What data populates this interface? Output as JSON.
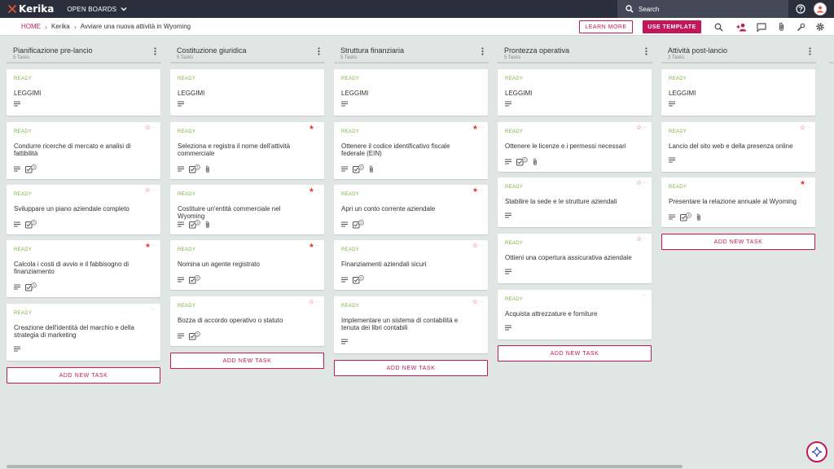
{
  "topbar": {
    "logo_text": "Kerika",
    "open_boards": "OPEN BOARDS",
    "search_placeholder": "Search"
  },
  "breadcrumb": {
    "home": "HOME",
    "org": "Kerika",
    "board": "Avviare una nuova attività in Wyoming"
  },
  "toolbar": {
    "learn_more": "LEARN MORE",
    "use_template": "USE TEMPLATE"
  },
  "add_task_label": "ADD NEW TASK",
  "colors": {
    "accent": "#c2185b",
    "ready": "#7cb342",
    "star": "#e53935",
    "topbar": "#2b2f3c"
  },
  "columns": [
    {
      "title": "Pianificazione pre-lancio",
      "count": "5 Tasks",
      "cards": [
        {
          "status": "READY",
          "title": "LEGGIMI",
          "star": "none",
          "checklist": "",
          "attachment": false
        },
        {
          "status": "READY",
          "title": "Condurre ricerche di mercato e analisi di fattibilità",
          "star": "outline",
          "checklist": "5",
          "attachment": false
        },
        {
          "status": "READY",
          "title": "Sviluppare un piano aziendale completo",
          "star": "outline",
          "checklist": "5",
          "attachment": false
        },
        {
          "status": "READY",
          "title": "Calcola i costi di avvio e il fabbisogno di finanziamento",
          "star": "filled",
          "checklist": "5",
          "attachment": false
        },
        {
          "status": "READY",
          "title": "Creazione dell'identità del marchio e della strategia di marketing",
          "star": "none",
          "checklist": "",
          "attachment": false
        }
      ]
    },
    {
      "title": "Costituzione giuridica",
      "count": "5 Tasks",
      "cards": [
        {
          "status": "READY",
          "title": "LEGGIMI",
          "star": "none",
          "checklist": "",
          "attachment": false
        },
        {
          "status": "READY",
          "title": "Seleziona e registra il nome dell'attività commerciale",
          "star": "filled",
          "checklist": "5",
          "attachment": true
        },
        {
          "status": "READY",
          "title": "Costituire un'entità commerciale nel Wyoming",
          "star": "filled",
          "checklist": "5",
          "attachment": true
        },
        {
          "status": "READY",
          "title": "Nomina un agente registrato",
          "star": "filled",
          "checklist": "5",
          "attachment": false
        },
        {
          "status": "READY",
          "title": "Bozza di accordo operativo o statuto",
          "star": "outline",
          "checklist": "5",
          "attachment": false
        }
      ]
    },
    {
      "title": "Struttura finanziaria",
      "count": "5 Tasks",
      "cards": [
        {
          "status": "READY",
          "title": "LEGGIMI",
          "star": "none",
          "checklist": "",
          "attachment": false
        },
        {
          "status": "READY",
          "title": "Ottenere il codice identificativo fiscale federale (EIN)",
          "star": "filled",
          "checklist": "5",
          "attachment": true
        },
        {
          "status": "READY",
          "title": "Apri un conto corrente aziendale",
          "star": "filled",
          "checklist": "5",
          "attachment": false
        },
        {
          "status": "READY",
          "title": "Finanziamenti aziendali sicuri",
          "star": "outline",
          "checklist": "5",
          "attachment": false
        },
        {
          "status": "READY",
          "title": "Implementare un sistema di contabilità e tenuta dei libri contabili",
          "star": "outline",
          "checklist": "",
          "attachment": false
        }
      ]
    },
    {
      "title": "Prontezza operativa",
      "count": "5 Tasks",
      "cards": [
        {
          "status": "READY",
          "title": "LEGGIMI",
          "star": "none",
          "checklist": "",
          "attachment": false
        },
        {
          "status": "READY",
          "title": "Ottenere le licenze e i permessi necessari",
          "star": "outline",
          "checklist": "5",
          "attachment": true
        },
        {
          "status": "READY",
          "title": "Stabilire la sede e le strutture aziendali",
          "star": "outline",
          "checklist": "",
          "attachment": false
        },
        {
          "status": "READY",
          "title": "Ottieni una copertura assicurativa aziendale",
          "star": "outline",
          "checklist": "",
          "attachment": false
        },
        {
          "status": "READY",
          "title": "Acquista attrezzature e forniture",
          "star": "none",
          "checklist": "",
          "attachment": false
        }
      ]
    },
    {
      "title": "Attività post-lancio",
      "count": "3 Tasks",
      "cards": [
        {
          "status": "READY",
          "title": "LEGGIMI",
          "star": "none",
          "checklist": "",
          "attachment": false
        },
        {
          "status": "READY",
          "title": "Lancio del sito web e della presenza online",
          "star": "outline",
          "checklist": "",
          "attachment": false
        },
        {
          "status": "READY",
          "title": "Presentare la relazione annuale al Wyoming",
          "star": "filled",
          "checklist": "4",
          "attachment": true
        }
      ]
    }
  ]
}
